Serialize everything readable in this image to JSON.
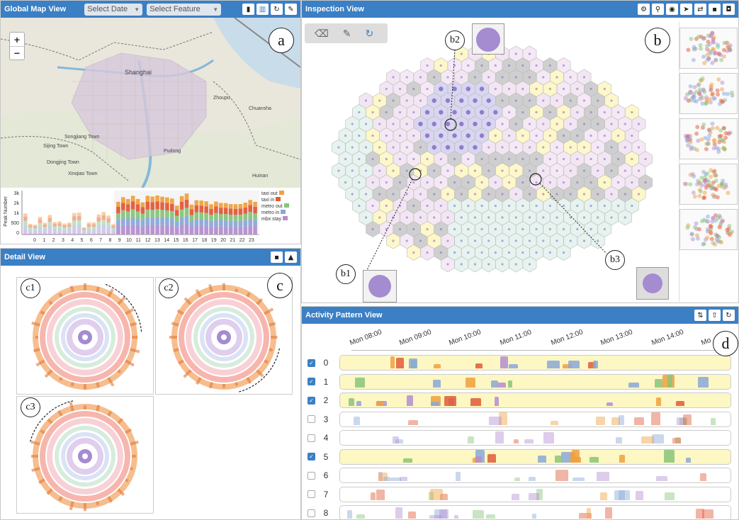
{
  "global_map": {
    "title": "Global Map View",
    "select_date": "Select Date",
    "select_feature": "Select Feature",
    "zoom_in": "+",
    "zoom_out": "−",
    "map_labels": [
      "Shanghai",
      "Songjiang Town",
      "Sijing Town",
      "Dongjing Town",
      "Xinqiao Town",
      "Zhoupu",
      "Chuansha",
      "Huinan",
      "Pudong"
    ],
    "chart": {
      "ylabel": "Peak Number",
      "yticks": [
        "3k",
        "2k",
        "1k",
        "500",
        "0"
      ],
      "xticks": [
        "0",
        "1",
        "2",
        "3",
        "4",
        "5",
        "6",
        "7",
        "8",
        "9",
        "10",
        "11",
        "12",
        "13",
        "14",
        "15",
        "16",
        "17",
        "18",
        "19",
        "20",
        "21",
        "22",
        "23"
      ],
      "legend": [
        "taxi out",
        "taxi in",
        "metro out",
        "metro in",
        "mbx stay"
      ]
    },
    "annotation": "a"
  },
  "inspection": {
    "title": "Inspection View",
    "annotations": [
      "b",
      "b1",
      "b2",
      "b3"
    ]
  },
  "detail": {
    "title": "Detail View",
    "annotations": [
      "c1",
      "c2",
      "c3",
      "c"
    ]
  },
  "activity": {
    "title": "Activity Pattern View",
    "annotation": "d",
    "times": [
      "Mon 08:00",
      "Mon 09:00",
      "Mon 10:00",
      "Mon 11:00",
      "Mon 12:00",
      "Mon 13:00",
      "Mon 14:00",
      "Mo"
    ],
    "rows": [
      {
        "label": "0",
        "checked": true
      },
      {
        "label": "1",
        "checked": true
      },
      {
        "label": "2",
        "checked": true
      },
      {
        "label": "3",
        "checked": false
      },
      {
        "label": "4",
        "checked": false
      },
      {
        "label": "5",
        "checked": true
      },
      {
        "label": "6",
        "checked": false
      },
      {
        "label": "7",
        "checked": false
      },
      {
        "label": "8",
        "checked": false
      }
    ]
  },
  "colors": {
    "header": "#3b7fc4",
    "highlight": "#fdf7c4",
    "taxi_out": "#f0a040",
    "taxi_in": "#e05a3a",
    "metro_out": "#88c47a",
    "metro_in": "#8aa8d8",
    "mbx_stay": "#b38ed0"
  }
}
